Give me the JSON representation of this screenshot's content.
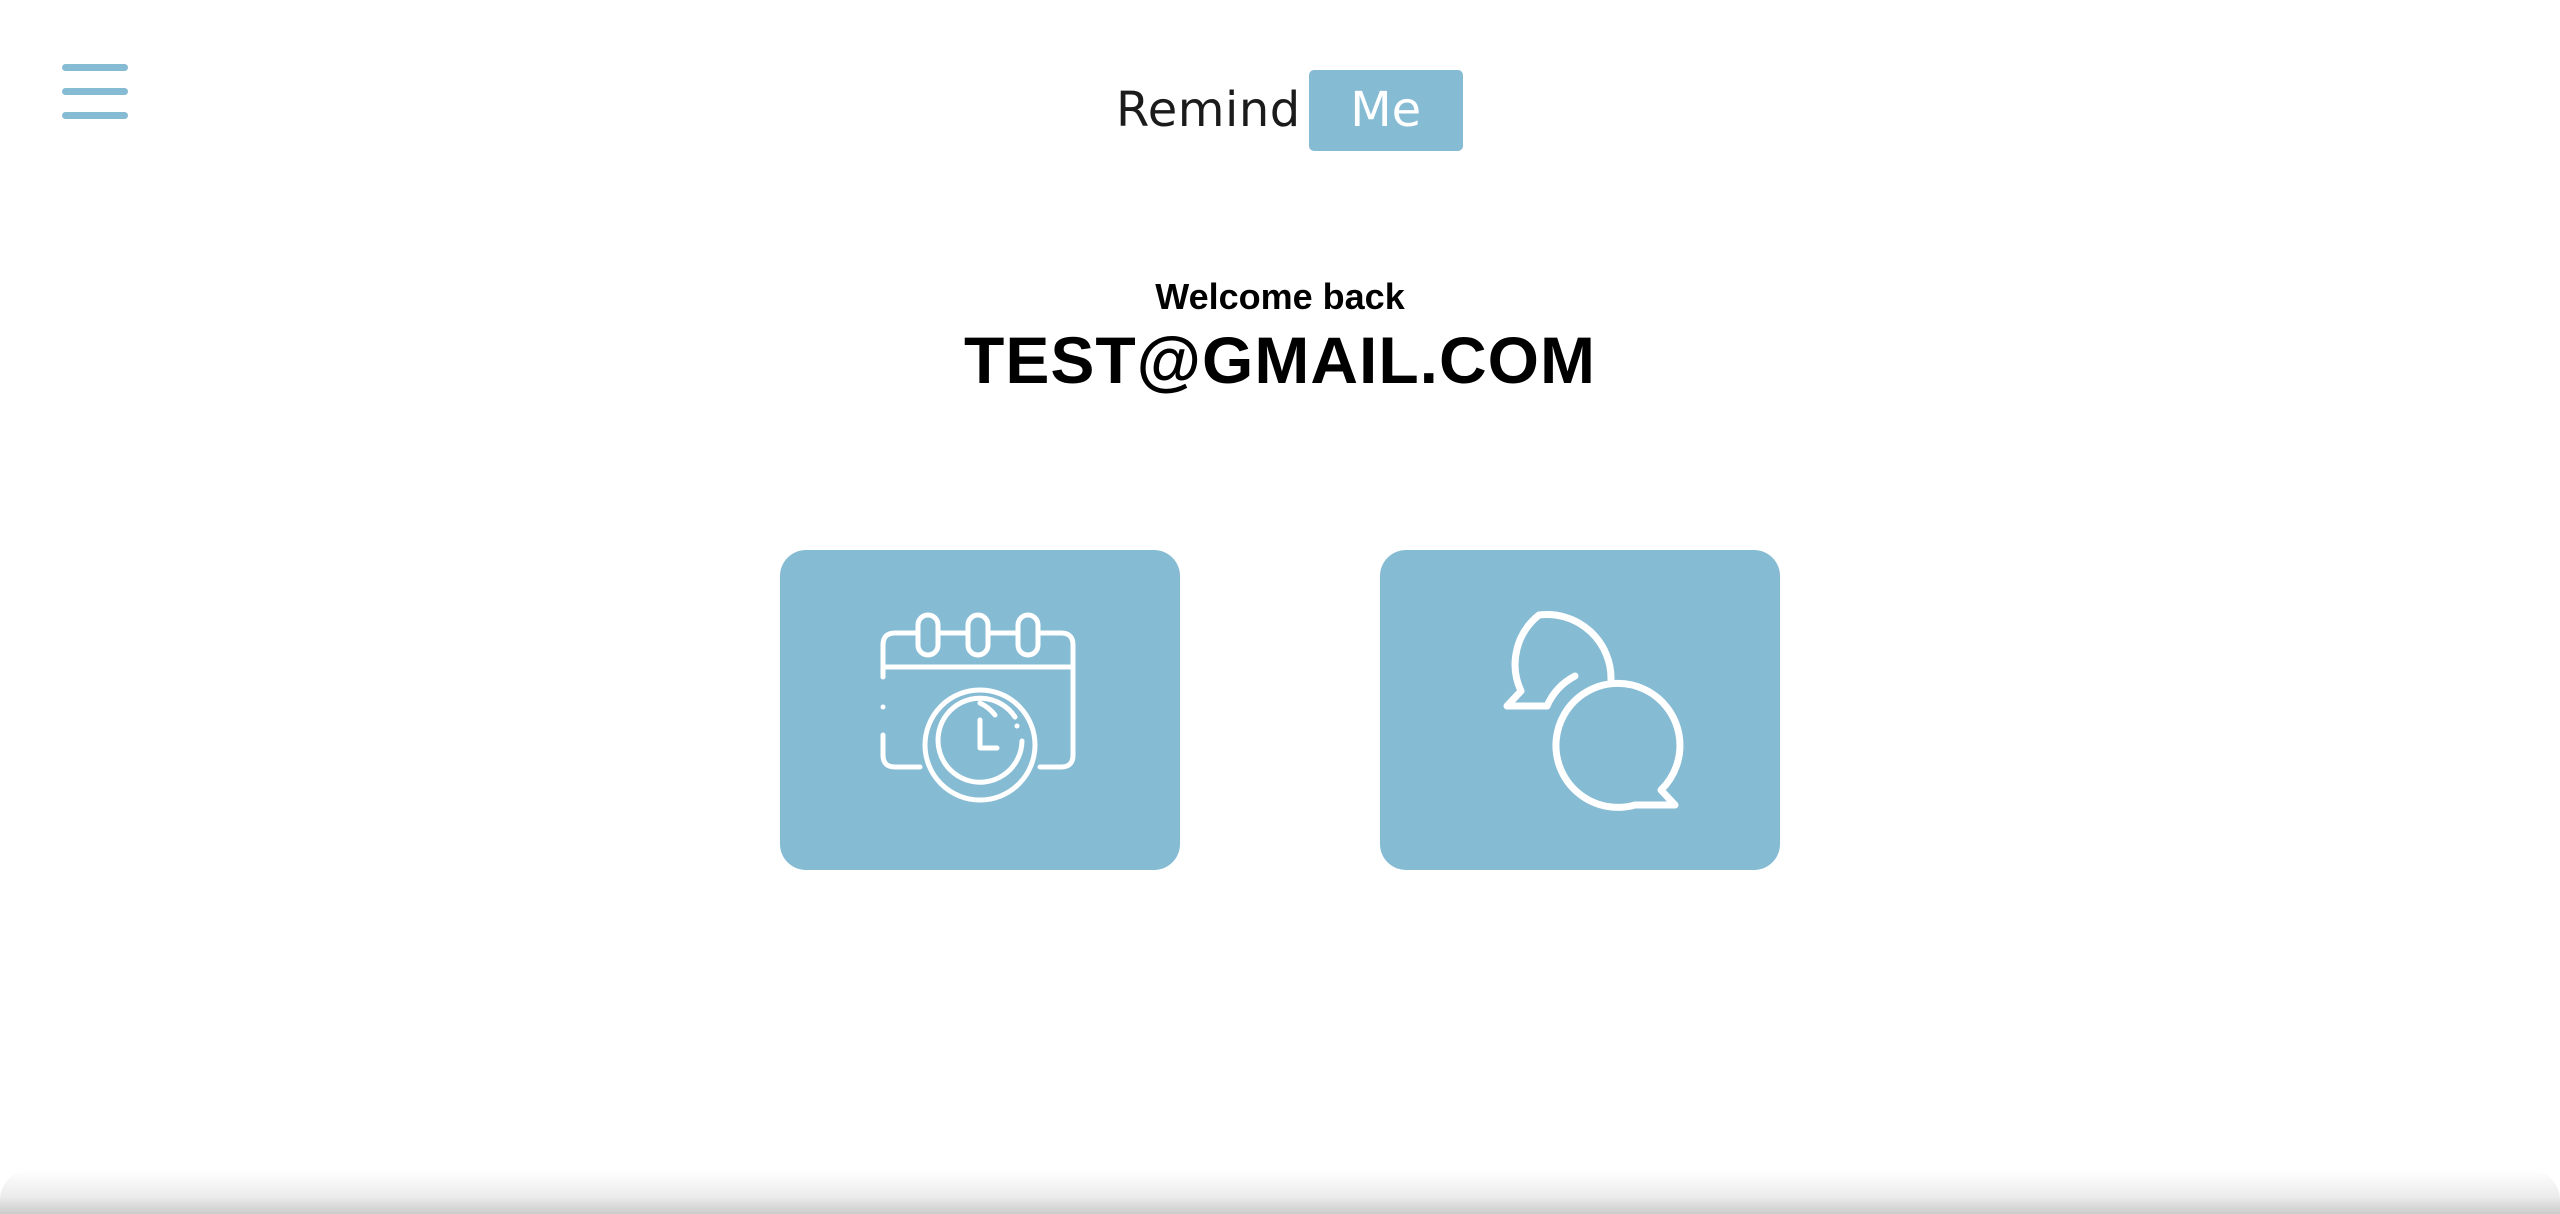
{
  "header": {
    "logo_word": "Remind",
    "logo_badge": "Me"
  },
  "main": {
    "welcome_text": "Welcome back",
    "user_email": "TEST@GMAIL.COM",
    "tiles": [
      {
        "icon": "calendar-clock-icon"
      },
      {
        "icon": "chat-bubbles-icon"
      }
    ]
  },
  "colors": {
    "accent": "#86bbd4",
    "text": "#000000",
    "background": "#ffffff"
  }
}
